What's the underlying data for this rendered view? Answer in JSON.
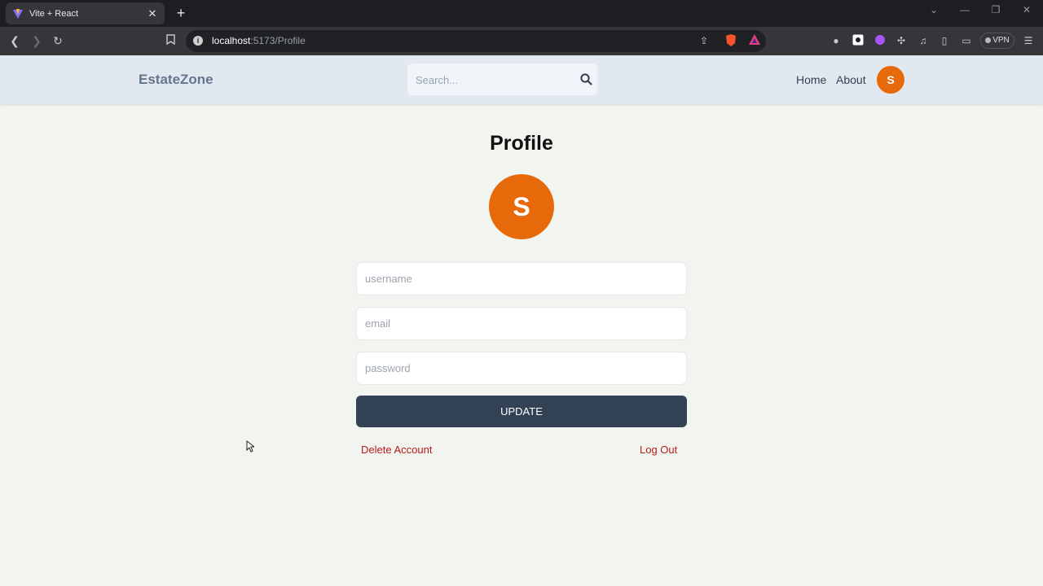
{
  "browser": {
    "tab_title": "Vite + React",
    "url_host": "localhost",
    "url_path": ":5173/Profile",
    "vpn_label": "VPN"
  },
  "header": {
    "logo": "EstateZone",
    "search_placeholder": "Search...",
    "nav": [
      "Home",
      "About"
    ],
    "avatar_initial": "S"
  },
  "profile": {
    "title": "Profile",
    "avatar_initial": "S",
    "username_placeholder": "username",
    "email_placeholder": "email",
    "password_placeholder": "password",
    "update_label": "UPDATE",
    "delete_label": "Delete Account",
    "logout_label": "Log Out"
  },
  "colors": {
    "accent": "#e66a0a",
    "button": "#334155",
    "danger": "#b91c1c",
    "header_bg": "#e2e8f0",
    "page_bg": "#f1f4ef"
  }
}
